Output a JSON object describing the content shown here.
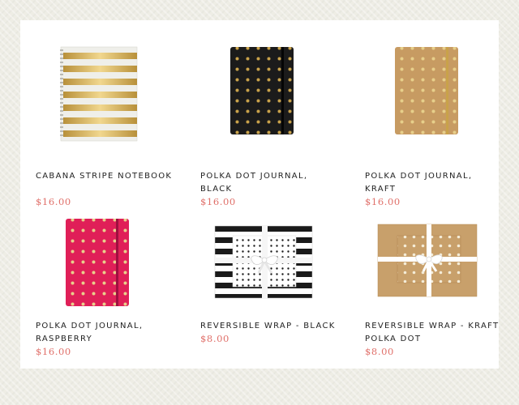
{
  "theme": {
    "background": "#eeede5",
    "panel": "#ffffff",
    "text": "#222222",
    "price": "#e0706a",
    "gold": "#c9a24a"
  },
  "products": [
    {
      "name": "CABANA STRIPE NOTEBOOK",
      "price": "$16.00",
      "image_icon": "striped-spiral-notebook"
    },
    {
      "name": "POLKA DOT JOURNAL, BLACK",
      "price": "$16.00",
      "image_icon": "black-polka-dot-journal"
    },
    {
      "name": "POLKA DOT JOURNAL, KRAFT",
      "price": "$16.00",
      "image_icon": "kraft-polka-dot-journal"
    },
    {
      "name": "POLKA DOT JOURNAL, RASPBERRY",
      "price": "$16.00",
      "image_icon": "raspberry-polka-dot-journal"
    },
    {
      "name": "REVERSIBLE WRAP - BLACK",
      "price": "$8.00",
      "image_icon": "black-stripe-gift-wrap"
    },
    {
      "name": "REVERSIBLE WRAP - KRAFT POLKA DOT",
      "price": "$8.00",
      "image_icon": "kraft-dot-gift-wrap"
    }
  ]
}
